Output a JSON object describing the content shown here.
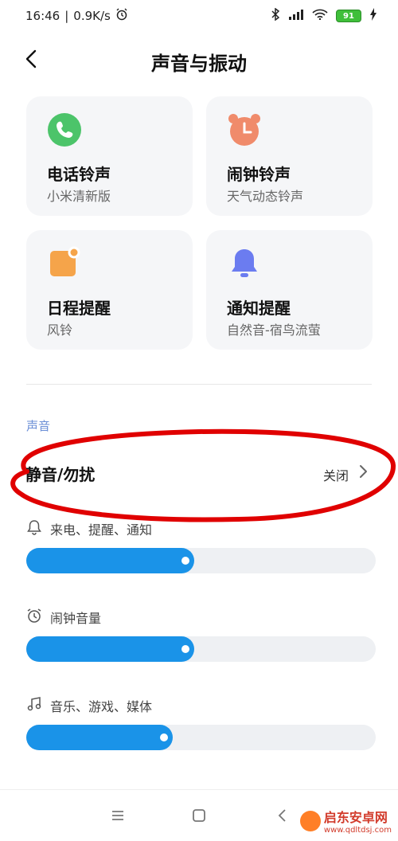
{
  "status_bar": {
    "time": "16:46",
    "speed": "0.9K/s",
    "battery": "91",
    "icons": [
      "alarm-icon",
      "bluetooth-icon",
      "signal-icon",
      "wifi-icon",
      "battery-icon",
      "charging-icon"
    ]
  },
  "header": {
    "title": "声音与振动",
    "back_icon": "back-arrow-icon"
  },
  "cards": [
    {
      "name": "电话铃声",
      "sub": "小米清新版",
      "icon": "phone-icon",
      "color": "#4cc46a"
    },
    {
      "name": "闹钟铃声",
      "sub": "天气动态铃声",
      "icon": "alarm-clock-icon",
      "color": "#f08b6b"
    },
    {
      "name": "日程提醒",
      "sub": "风铃",
      "icon": "calendar-icon",
      "color": "#f5a44a"
    },
    {
      "name": "通知提醒",
      "sub": "自然音-宿鸟流萤",
      "icon": "bell-icon",
      "color": "#6b7cf0"
    }
  ],
  "section": {
    "label": "声音"
  },
  "dnd": {
    "label": "静音/勿扰",
    "value": "关闭"
  },
  "volumes": [
    {
      "label": "来电、提醒、通知",
      "icon": "bell-outline-icon",
      "level": 0.48
    },
    {
      "label": "闹钟音量",
      "icon": "alarm-outline-icon",
      "level": 0.48
    },
    {
      "label": "音乐、游戏、媒体",
      "icon": "music-note-icon",
      "level": 0.42
    }
  ],
  "nav": {
    "menu_icon": "menu-icon",
    "home_icon": "home-square-icon",
    "back_icon": "nav-back-icon"
  },
  "watermark": {
    "title": "启东安卓网",
    "url": "www.qdltdsj.com"
  },
  "colors": {
    "accent": "#1a93e8",
    "annotation": "#e00000",
    "section_label": "#6a8ed6"
  }
}
